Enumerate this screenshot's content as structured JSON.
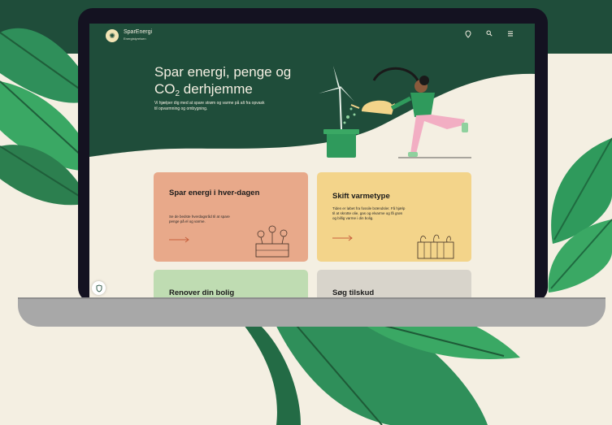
{
  "site": {
    "brand_name": "SparEnergi",
    "brand_sub": "Energistyrelsen",
    "nav_icons": [
      "location-pin-icon",
      "search-icon",
      "menu-icon"
    ]
  },
  "hero": {
    "title_line1": "Spar energi, penge og",
    "title_co": "CO",
    "title_sub": "2",
    "title_rest": " derhjemme",
    "lead": "Vi hjælper dig med at spare strøm og varme på alt fra opvask til opvarmning og ombygning."
  },
  "cards": [
    {
      "title": "Spar energi i hver-dagen",
      "text": "Se de bedste hverdagsråd til at spare penge på el og varme.",
      "color": "#e8a98a"
    },
    {
      "title": "Skift varmetype",
      "text": "Tiden er løbet fra fossile brændsler. Få hjælp til at skrotte olie, gas og elvarme og få grøn og billig varme i din bolig.",
      "color": "#f3d48a"
    },
    {
      "title": "Renover din bolig",
      "color": "#bfdcb2"
    },
    {
      "title": "Søg tilskud",
      "color": "#d8d4cb"
    }
  ],
  "colors": {
    "dark_green": "#1f4d3a",
    "accent_arrow": "#c8613e",
    "bezel": "#141221"
  }
}
